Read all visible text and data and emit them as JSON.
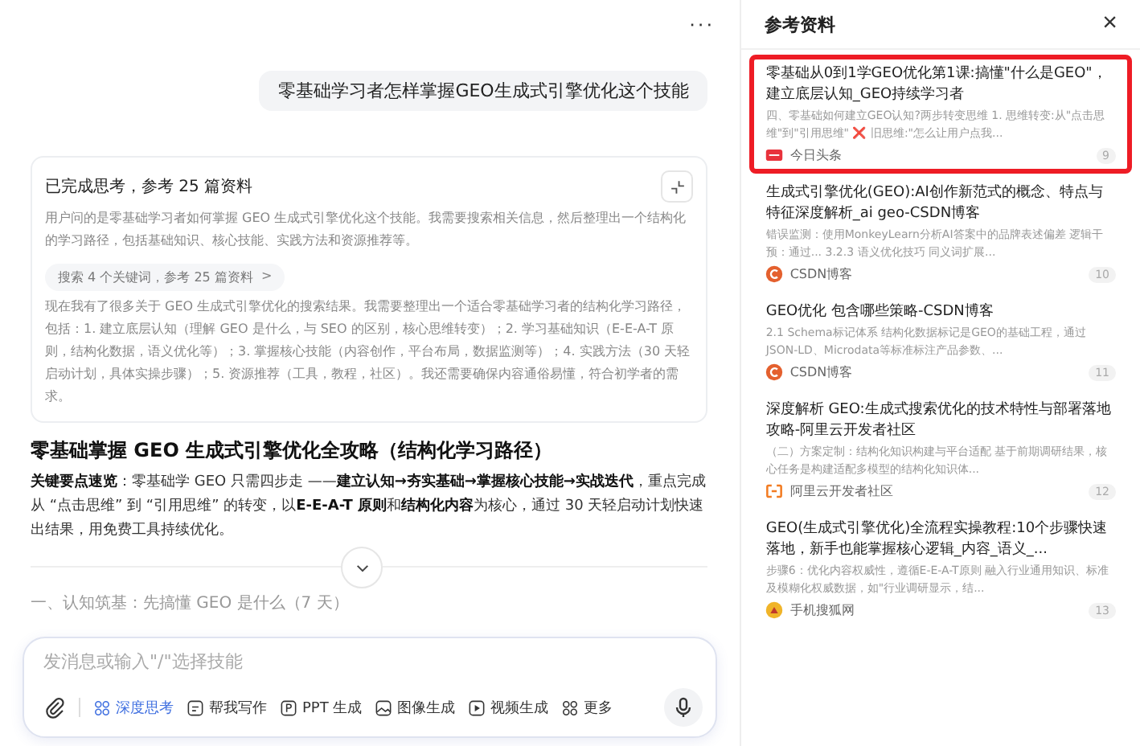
{
  "chat": {
    "more_button": "···",
    "user_message": "零基础学习者怎样掌握GEO生成式引擎优化这个技能",
    "thinking": {
      "title": "已完成思考，参考 25 篇资料",
      "expanded": true,
      "intro": "用户问的是零基础学习者如何掌握 GEO 生成式引擎优化这个技能。我需要搜索相关信息，然后整理出一个结构化的学习路径，包括基础知识、核心技能、实践方法和资源推荐等。",
      "search_chip": "搜索 4 个关键词，参考 25 篇资料",
      "search_chip_arrow": ">",
      "plan": "现在我有了很多关于 GEO 生成式引擎优化的搜索结果。我需要整理出一个适合零基础学习者的结构化学习路径，包括：1. 建立底层认知（理解 GEO 是什么，与 SEO 的区别，核心思维转变）；2. 学习基础知识（E-E-A-T 原则，结构化数据，语义优化等）；3. 掌握核心技能（内容创作，平台布局，数据监测等）；4. 实践方法（30 天轻启动计划，具体实操步骤）；5. 资源推荐（工具，教程，社区）。我还需要确保内容通俗易懂，符合初学者的需求。"
    },
    "answer_title": "零基础掌握 GEO 生成式引擎优化全攻略（结构化学习路径）",
    "answer_summary": "**关键要点速览**：零基础学 GEO 只需四步走 ——**建立认知→夯实基础→掌握核心技能→实战迭代**，重点完成从 “点击思维” 到 “引用思维” 的转变，以**E-E-A-T 原则**和**结构化内容**为核心，通过 30 天轻启动计划快速出结果，用免费工具持续优化。",
    "next_section": "一、认知筑基：先搞懂 GEO 是什么（7 天）",
    "input": {
      "placeholder": "发消息或输入\"/\"选择技能",
      "tools": [
        {
          "label": "深度思考",
          "kind": "think",
          "selected": true
        },
        {
          "label": "帮我写作",
          "kind": "write",
          "selected": false
        },
        {
          "label": "PPT 生成",
          "kind": "ppt",
          "selected": false
        },
        {
          "label": "图像生成",
          "kind": "image",
          "selected": false
        },
        {
          "label": "视频生成",
          "kind": "video",
          "selected": false
        },
        {
          "label": "更多",
          "kind": "more",
          "selected": false
        }
      ]
    }
  },
  "references": {
    "title": "参考资料",
    "close": "×",
    "items": [
      {
        "title": "零基础从0到1学GEO优化第1课:搞懂\"什么是GEO\"，建立底层认知_GEO持续学习者",
        "snippet": "四、零基础如何建立GEO认知?两步转变思维 1. 思维转变:从\"点击思维\"到\"引用思维\" ❌ 旧思维:\"怎么让用户点我...",
        "source": "今日头条",
        "kind": "toutiao",
        "index": "9",
        "highlighted": true
      },
      {
        "title": "生成式引擎优化(GEO):AI创作新范式的概念、特点与特征深度解析_ai geo-CSDN博客",
        "snippet": "错误监测：使用MonkeyLearn分析AI答案中的品牌表述偏差 逻辑干预：通过... 3.2.3 语义优化技巧 同义词扩展...",
        "source": "CSDN博客",
        "kind": "csdn",
        "index": "10",
        "highlighted": false
      },
      {
        "title": "GEO优化 包含哪些策略-CSDN博客",
        "snippet": "2.1 Schema标记体系 结构化数据标记是GEO的基础工程，通过JSON-LD、Microdata等标准标注产品参数、...",
        "source": "CSDN博客",
        "kind": "csdn",
        "index": "11",
        "highlighted": false
      },
      {
        "title": "深度解析 GEO:生成式搜索优化的技术特性与部署落地攻略-阿里云开发者社区",
        "snippet": "（二）方案定制：结构化知识构建与平台适配 基于前期调研结果，核心任务是构建适配多模型的结构化知识体...",
        "source": "阿里云开发者社区",
        "kind": "aliyun",
        "index": "12",
        "highlighted": false
      },
      {
        "title": "GEO(生成式引擎优化)全流程实操教程:10个步骤快速落地，新手也能掌握核心逻辑_内容_语义_...",
        "snippet": "步骤6：优化内容权威性，遵循E-E-A-T原则 融入行业通用知识、标准及模糊化权威数据，如\"行业调研显示，结...",
        "source": "手机搜狐网",
        "kind": "sohu",
        "index": "13",
        "highlighted": false
      }
    ]
  }
}
